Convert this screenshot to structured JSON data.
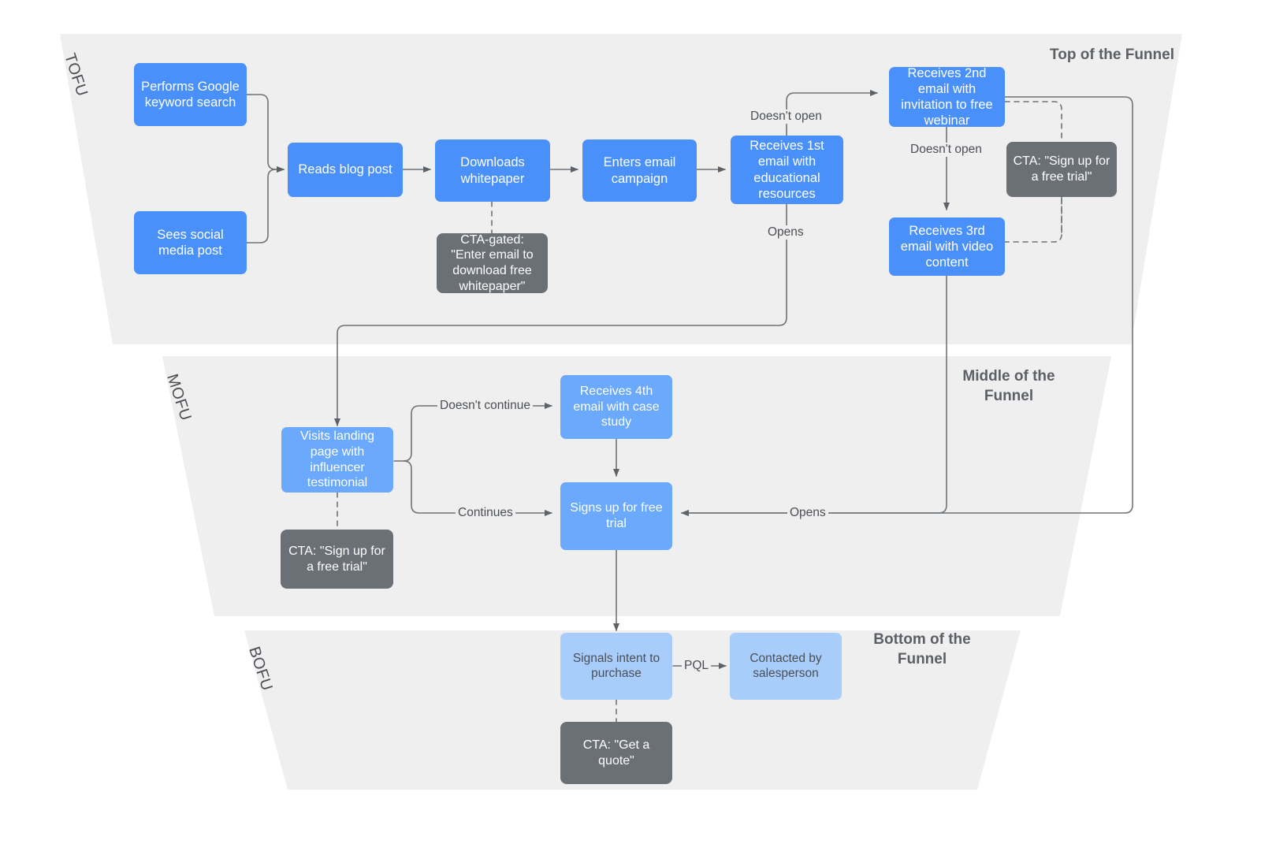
{
  "diagram": {
    "title": "Marketing funnel journey flowchart",
    "background": "#ffffff",
    "band_fill": "#efefef",
    "colors": {
      "tofu_node": "#4a90fa",
      "mofu_node": "#6aa9fb",
      "bofu_node": "#a9cdfb",
      "cta_node": "#6b7077",
      "edge": "#6f7479",
      "stage_title": "#5c6066"
    }
  },
  "stages": [
    {
      "abbr": "TOFU",
      "title": "Top of the Funnel"
    },
    {
      "abbr": "MOFU",
      "title": "Middle of the\nFunnel",
      "title_line1": "Middle of the",
      "title_line2": "Funnel"
    },
    {
      "abbr": "BOFU",
      "title": "Bottom of the\nFunnel",
      "title_line1": "Bottom of the",
      "title_line2": "Funnel"
    }
  ],
  "nodes": {
    "google_search": "Performs Google keyword search",
    "social_post": "Sees social media post",
    "blog_post": "Reads blog post",
    "whitepaper": "Downloads whitepaper",
    "email_campaign": "Enters email campaign",
    "email1": "Receives 1st email with educational resources",
    "email2": "Receives 2nd email with invitation to free webinar",
    "email3": "Receives 3rd email with video content",
    "landing_page": "Visits landing page with influencer testimonial",
    "email4": "Receives 4th email with case study",
    "free_trial": "Signs up for free trial",
    "intent": "Signals intent to purchase",
    "salesperson": "Contacted by salesperson"
  },
  "ctas": {
    "whitepaper_cta": "CTA-gated: \"Enter email to download free whitepaper\"",
    "webinar_cta": "CTA: \"Sign up for a free trial\"",
    "landing_cta": "CTA: \"Sign up for a free trial\"",
    "quote_cta": "CTA: \"Get a quote\""
  },
  "edge_labels": {
    "doesnt_open_1": "Doesn't open",
    "doesnt_open_2": "Doesn't open",
    "opens_1": "Opens",
    "opens_2": "Opens",
    "doesnt_continue": "Doesn't continue",
    "continues": "Continues",
    "pql": "PQL"
  }
}
